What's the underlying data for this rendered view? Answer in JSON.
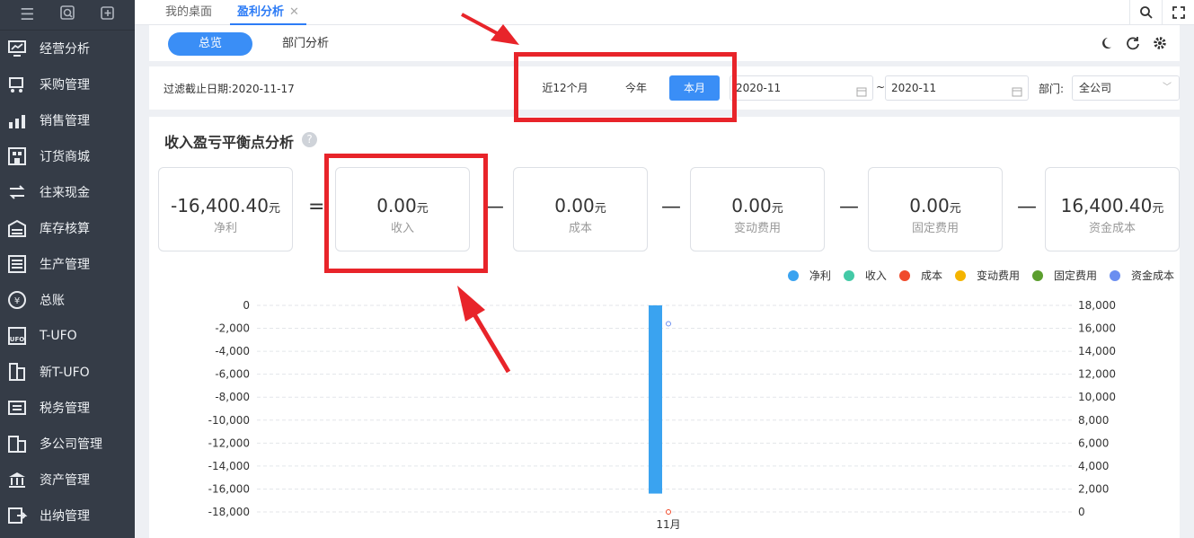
{
  "sidebar": {
    "top_icons": [
      "menu-icon",
      "search-doc-icon",
      "add-page-icon"
    ],
    "items": [
      {
        "label": "经营分析",
        "icon": "analytics-icon"
      },
      {
        "label": "采购管理",
        "icon": "cart-icon"
      },
      {
        "label": "销售管理",
        "icon": "sales-chart-icon"
      },
      {
        "label": "订货商城",
        "icon": "store-icon"
      },
      {
        "label": "往来现金",
        "icon": "exchange-icon"
      },
      {
        "label": "库存核算",
        "icon": "warehouse-icon"
      },
      {
        "label": "生产管理",
        "icon": "production-icon"
      },
      {
        "label": "总账",
        "icon": "ledger-icon"
      },
      {
        "label": "T-UFO",
        "icon": "ufo-icon"
      },
      {
        "label": "新T-UFO",
        "icon": "building-icon"
      },
      {
        "label": "税务管理",
        "icon": "tax-icon"
      },
      {
        "label": "多公司管理",
        "icon": "companies-icon"
      },
      {
        "label": "资产管理",
        "icon": "bank-icon"
      },
      {
        "label": "出纳管理",
        "icon": "cashier-icon"
      }
    ]
  },
  "tabs": [
    {
      "label": "我的桌面",
      "active": false
    },
    {
      "label": "盈利分析",
      "active": true,
      "close": "✕"
    }
  ],
  "subnav": {
    "tabs": [
      {
        "label": "总览",
        "active": true
      },
      {
        "label": "部门分析",
        "active": false
      }
    ]
  },
  "filter": {
    "date_text": "过滤截止日期:2020-11-17",
    "periods": [
      {
        "label": "近12个月",
        "active": false
      },
      {
        "label": "今年",
        "active": false
      },
      {
        "label": "本月",
        "active": true
      }
    ],
    "start": "2020-11",
    "tilde": "~",
    "end": "2020-11",
    "dept_label": "部门:",
    "dept_value": "全公司"
  },
  "section": {
    "title": "收入盈亏平衡点分析",
    "help": "?",
    "unit": "元",
    "cards": [
      {
        "value": "-16,400.40",
        "name": "净利"
      },
      {
        "value": "0.00",
        "name": "收入"
      },
      {
        "value": "0.00",
        "name": "成本"
      },
      {
        "value": "0.00",
        "name": "变动费用"
      },
      {
        "value": "0.00",
        "name": "固定费用"
      },
      {
        "value": "16,400.40",
        "name": "资金成本"
      }
    ],
    "operators": [
      "=",
      "—",
      "—",
      "—",
      "—"
    ]
  },
  "legend": [
    {
      "name": "净利",
      "color": "#3aa3f0"
    },
    {
      "name": "收入",
      "color": "#43c9a6"
    },
    {
      "name": "成本",
      "color": "#f04a2b"
    },
    {
      "name": "变动费用",
      "color": "#f4b400"
    },
    {
      "name": "固定费用",
      "color": "#5b9e2e"
    },
    {
      "name": "资金成本",
      "color": "#6b8ef0"
    }
  ],
  "chart_data": {
    "type": "bar",
    "categories": [
      "11月"
    ],
    "left_axis": {
      "ticks": [
        0,
        -2000,
        -4000,
        -6000,
        -8000,
        -10000,
        -12000,
        -14000,
        -16000,
        -18000
      ],
      "labels": [
        "0",
        "-2,000",
        "-4,000",
        "-6,000",
        "-8,000",
        "-10,000",
        "-12,000",
        "-14,000",
        "-16,000",
        "-18,000"
      ],
      "ylim": [
        -18000,
        0
      ]
    },
    "right_axis": {
      "ticks": [
        18000,
        16000,
        14000,
        12000,
        10000,
        8000,
        6000,
        4000,
        2000,
        0
      ],
      "labels": [
        "18,000",
        "16,000",
        "14,000",
        "12,000",
        "10,000",
        "8,000",
        "6,000",
        "4,000",
        "2,000",
        "0"
      ],
      "ylim": [
        0,
        18000
      ]
    },
    "series": [
      {
        "name": "净利",
        "type": "bar",
        "axis": "left",
        "values": [
          -16400.4
        ]
      },
      {
        "name": "资金成本",
        "type": "line",
        "axis": "right",
        "values": [
          16400.4
        ]
      },
      {
        "name": "成本",
        "type": "line",
        "axis": "right",
        "values": [
          0
        ]
      }
    ]
  }
}
